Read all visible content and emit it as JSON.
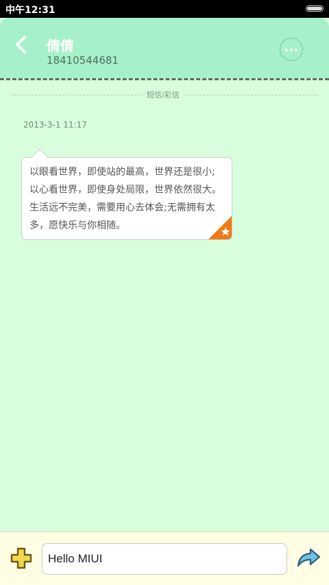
{
  "status_bar": {
    "time": "中午12:31",
    "battery_icon": "battery-icon"
  },
  "header": {
    "back_icon": "back-arrow-icon",
    "contact_name": "倩倩",
    "contact_number": "18410544681",
    "more_icon": "more-options-icon"
  },
  "thread": {
    "divider_label": "短信/彩信",
    "messages": [
      {
        "timestamp": "2013-3-1 11:17",
        "text": "以眼看世界，即使站的最高，世界还是很小;以心看世界，即使身处局限，世界依然很大。生活远不完美，需要用心去体会;无需拥有太多，愿快乐与你相随。",
        "starred_icon": "star-icon"
      }
    ]
  },
  "composer": {
    "add_icon": "plus-icon",
    "input_value": "Hello MIUI",
    "send_icon": "send-arrow-icon"
  },
  "colors": {
    "header_bg": "#a6f1c9",
    "thread_bg": "#d9fedd",
    "composer_bg": "#fffde3",
    "star_corner": "#f07a1a",
    "send_arrow": "#6ec2ea",
    "add_button": "#f2d64b"
  }
}
